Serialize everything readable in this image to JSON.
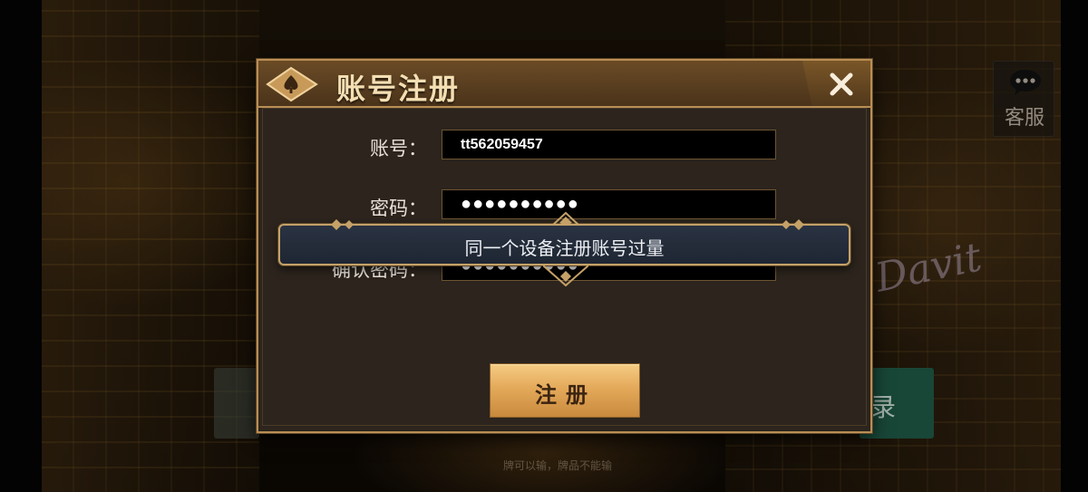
{
  "dialog": {
    "title": "账号注册",
    "fields": {
      "account_label": "账号：",
      "account_value": "tt562059457",
      "password_label": "密码：",
      "password_value": "●●●●●●●●●●",
      "confirm_label": "确认密码：",
      "confirm_value": "●●●●●●●●●●"
    },
    "register_label": "注册"
  },
  "toast": {
    "message": "同一个设备注册账号过量"
  },
  "service": {
    "label": "客服",
    "icon": "chat-bubble-icon"
  },
  "background": {
    "sign_text": "Davit",
    "right_button_partial": "录",
    "footer_text": "牌可以输，牌品不能输"
  },
  "colors": {
    "dialog_border": "#b98e54",
    "button_gold": "#e4a95a",
    "toast_bg": "#2a3342"
  }
}
